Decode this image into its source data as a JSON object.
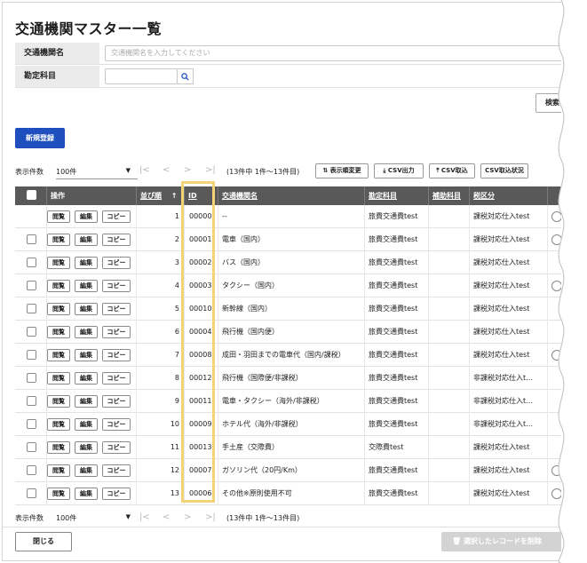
{
  "page": {
    "title": "交通機関マスター一覧"
  },
  "form": {
    "name_label": "交通機関名",
    "name_placeholder": "交通機関名を入力してください",
    "account_label": "勘定科目",
    "search_label": "検索"
  },
  "actions": {
    "new_label": "新規登録",
    "close_label": "閉じる",
    "release_label": "選択したレコードを削除"
  },
  "pager": {
    "count_label": "表示件数",
    "count_value": "100件",
    "info": "(13件中 1件～13件目)",
    "nav_first": "|<",
    "nav_prev": "<",
    "nav_next": ">",
    "nav_last": ">|"
  },
  "toolbar": {
    "order_change": "表示順変更",
    "csv_out": "CSV出力",
    "csv_in": "CSV取込",
    "csv_status": "CSV取込状況"
  },
  "columns": {
    "ops": "操作",
    "order": "並び順",
    "sort_arrow": "↑",
    "id": "ID",
    "name": "交通機関名",
    "account": "勘定科目",
    "sub": "補助科目",
    "tax": "税区分"
  },
  "row_buttons": {
    "view": "閲覧",
    "edit": "編集",
    "copy": "コピー"
  },
  "rows": [
    {
      "order": "1",
      "id": "00000",
      "name": "--",
      "account": "旅費交通費test",
      "tax": "課税対応仕入test",
      "checkbox": false,
      "radio": true
    },
    {
      "order": "2",
      "id": "00001",
      "name": "電車（国内）",
      "account": "旅費交通費test",
      "tax": "課税対応仕入test",
      "checkbox": true,
      "radio": true
    },
    {
      "order": "3",
      "id": "00002",
      "name": "バス（国内）",
      "account": "旅費交通費test",
      "tax": "課税対応仕入test",
      "checkbox": true,
      "radio": false
    },
    {
      "order": "4",
      "id": "00003",
      "name": "タクシー（国内）",
      "account": "旅費交通費test",
      "tax": "課税対応仕入test",
      "checkbox": true,
      "radio": true
    },
    {
      "order": "5",
      "id": "00010",
      "name": "新幹線（国内）",
      "account": "旅費交通費test",
      "tax": "課税対応仕入test",
      "checkbox": true,
      "radio": false
    },
    {
      "order": "6",
      "id": "00004",
      "name": "飛行機（国内便）",
      "account": "旅費交通費test",
      "tax": "課税対応仕入test",
      "checkbox": true,
      "radio": false
    },
    {
      "order": "7",
      "id": "00008",
      "name": "成田・羽田までの電車代（国内/課税）",
      "account": "旅費交通費test",
      "tax": "課税対応仕入test",
      "checkbox": true,
      "radio": true
    },
    {
      "order": "8",
      "id": "00012",
      "name": "飛行機（国際便/非課税）",
      "account": "旅費交通費test",
      "tax": "非課税対応仕入t…",
      "checkbox": true,
      "radio": false
    },
    {
      "order": "9",
      "id": "00011",
      "name": "電車・タクシー（海外/非課税）",
      "account": "旅費交通費test",
      "tax": "非課税対応仕入t…",
      "checkbox": true,
      "radio": false
    },
    {
      "order": "10",
      "id": "00009",
      "name": "ホテル代（海外/非課税）",
      "account": "旅費交通費test",
      "tax": "非課税対応仕入t…",
      "checkbox": true,
      "radio": false
    },
    {
      "order": "11",
      "id": "00013",
      "name": "手土産（交際費）",
      "account": "交際費test",
      "tax": "課税対応仕入test",
      "checkbox": true,
      "radio": false
    },
    {
      "order": "12",
      "id": "00007",
      "name": "ガソリン代（20円/Km）",
      "account": "旅費交通費test",
      "tax": "課税対応仕入test",
      "checkbox": true,
      "radio": true
    },
    {
      "order": "13",
      "id": "00006",
      "name": "その他※原則使用不可",
      "account": "旅費交通費test",
      "tax": "課税対応仕入test",
      "checkbox": true,
      "radio": true
    }
  ]
}
